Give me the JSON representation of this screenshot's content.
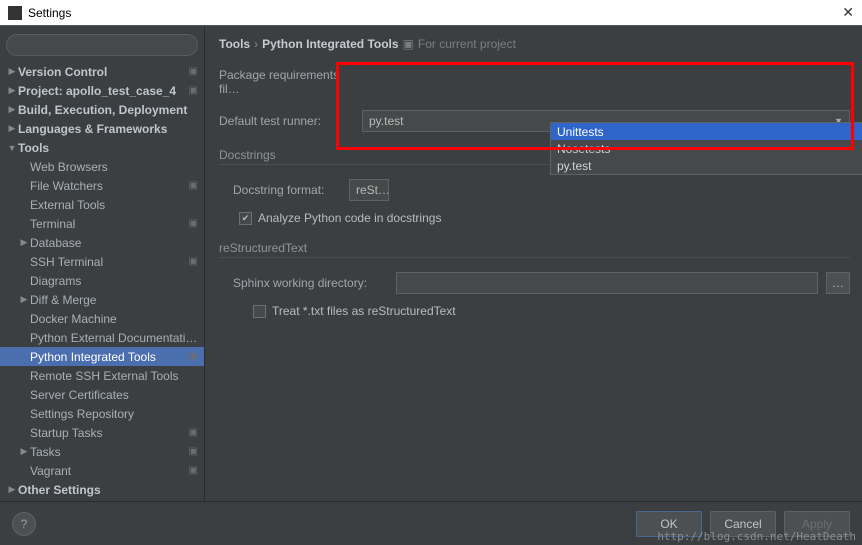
{
  "window": {
    "title": "Settings",
    "close_glyph": "✕"
  },
  "search": {
    "placeholder": "",
    "icon": "🔍"
  },
  "sidebar": {
    "items": [
      {
        "label": "Version Control",
        "level": 0,
        "bold": true,
        "expand": "▶",
        "proj": true
      },
      {
        "label": "Project: apollo_test_case_4",
        "level": 0,
        "bold": true,
        "expand": "▶",
        "proj": true
      },
      {
        "label": "Build, Execution, Deployment",
        "level": 0,
        "bold": true,
        "expand": "▶"
      },
      {
        "label": "Languages & Frameworks",
        "level": 0,
        "bold": true,
        "expand": "▶"
      },
      {
        "label": "Tools",
        "level": 0,
        "bold": true,
        "expand": "▼"
      },
      {
        "label": "Web Browsers",
        "level": 1
      },
      {
        "label": "File Watchers",
        "level": 1,
        "proj": true
      },
      {
        "label": "External Tools",
        "level": 1
      },
      {
        "label": "Terminal",
        "level": 1,
        "proj": true
      },
      {
        "label": "Database",
        "level": 1,
        "expand": "▶"
      },
      {
        "label": "SSH Terminal",
        "level": 1,
        "proj": true
      },
      {
        "label": "Diagrams",
        "level": 1
      },
      {
        "label": "Diff & Merge",
        "level": 1,
        "expand": "▶"
      },
      {
        "label": "Docker Machine",
        "level": 1
      },
      {
        "label": "Python External Documentation",
        "level": 1
      },
      {
        "label": "Python Integrated Tools",
        "level": 1,
        "selected": true,
        "proj": true
      },
      {
        "label": "Remote SSH External Tools",
        "level": 1
      },
      {
        "label": "Server Certificates",
        "level": 1
      },
      {
        "label": "Settings Repository",
        "level": 1
      },
      {
        "label": "Startup Tasks",
        "level": 1,
        "proj": true
      },
      {
        "label": "Tasks",
        "level": 1,
        "expand": "▶",
        "proj": true
      },
      {
        "label": "Vagrant",
        "level": 1,
        "proj": true
      },
      {
        "label": "Other Settings",
        "level": 0,
        "bold": true,
        "expand": "▶"
      }
    ]
  },
  "breadcrumb": {
    "part1": "Tools",
    "sep": "›",
    "part2": "Python Integrated Tools",
    "for_label": "For current project"
  },
  "form": {
    "pkg_req_label": "Package requirements fil…",
    "test_runner_label": "Default test runner:",
    "test_runner_value": "py.test",
    "docstrings_section": "Docstrings",
    "docstring_format_label": "Docstring format:",
    "docstring_format_value": "reSt…",
    "analyze_label": "Analyze Python code in docstrings",
    "rst_section": "reStructuredText",
    "sphinx_label": "Sphinx working directory:",
    "treat_txt_label": "Treat *.txt files as reStructuredText"
  },
  "dropdown": {
    "options": [
      "Unittests",
      "Nosetests",
      "py.test"
    ],
    "selected_index": 0
  },
  "buttons": {
    "help": "?",
    "ok": "OK",
    "cancel": "Cancel",
    "apply": "Apply"
  },
  "watermark": "http://blog.csdn.net/HeatDeath"
}
